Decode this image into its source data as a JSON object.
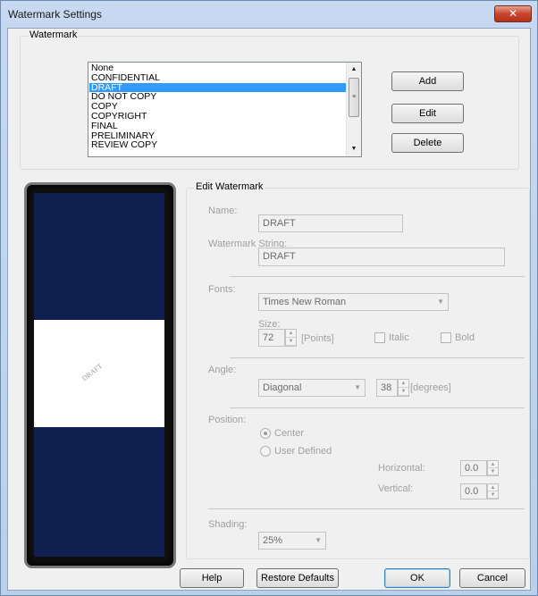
{
  "window": {
    "title": "Watermark Settings",
    "close_glyph": "✕"
  },
  "watermark_group": {
    "legend": "Watermark",
    "items": [
      "None",
      "CONFIDENTIAL",
      "DRAFT",
      "DO NOT COPY",
      "COPY",
      "COPYRIGHT",
      "FINAL",
      "PRELIMINARY",
      "REVIEW COPY"
    ],
    "selected": "DRAFT",
    "buttons": {
      "add": "Add",
      "edit": "Edit",
      "delete": "Delete"
    }
  },
  "preview": {
    "watermark_text": "DRAFT"
  },
  "edit": {
    "legend": "Edit Watermark",
    "name_label": "Name:",
    "name_value": "DRAFT",
    "string_label": "Watermark String:",
    "string_value": "DRAFT",
    "fonts_label": "Fonts:",
    "font_value": "Times New Roman",
    "size_label": "Size:",
    "size_value": "72",
    "size_unit": "[Points]",
    "italic_label": "Italic",
    "bold_label": "Bold",
    "angle_label": "Angle:",
    "angle_value": "Diagonal",
    "angle_degrees": "38",
    "angle_unit": "[degrees]",
    "position_label": "Position:",
    "center_label": "Center",
    "user_defined_label": "User Defined",
    "horizontal_label": "Horizontal:",
    "horizontal_value": "0.0",
    "vertical_label": "Vertical:",
    "vertical_value": "0.0",
    "shading_label": "Shading:",
    "shading_value": "25%"
  },
  "footer": {
    "help": "Help",
    "restore": "Restore Defaults",
    "ok": "OK",
    "cancel": "Cancel"
  }
}
